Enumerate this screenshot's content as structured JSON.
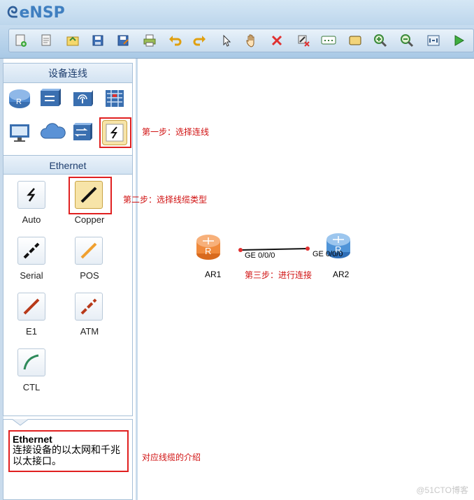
{
  "app": {
    "logo_mark": "ᘓ",
    "title": "eNSP"
  },
  "toolbar": {
    "icons": [
      "new-topology-icon",
      "new-example-icon",
      "open-icon",
      "save-icon",
      "save-as-icon",
      "print-icon",
      "undo-icon",
      "redo-icon",
      "select-icon",
      "pan-hand-icon",
      "delete-icon",
      "delete-link-icon",
      "text-annotation-icon",
      "rectangle-annotation-icon",
      "zoom-in-icon",
      "zoom-out-icon",
      "fit-icon",
      "start-device-icon"
    ]
  },
  "device_panel": {
    "title": "设备连线",
    "ethernet_title": "Ethernet",
    "cables": [
      {
        "label": "Auto"
      },
      {
        "label": "Copper"
      },
      {
        "label": "Serial"
      },
      {
        "label": "POS"
      },
      {
        "label": "E1"
      },
      {
        "label": "ATM"
      },
      {
        "label": "CTL"
      }
    ]
  },
  "description": {
    "title": "Ethernet",
    "text": "连接设备的以太网和千兆以太接口。"
  },
  "annotations": {
    "step1": "第一步：选择连线",
    "step2": "第二步：选择线缆类型",
    "step3": "第三步：进行连接",
    "desc_note": "对应线缆的介绍"
  },
  "topology": {
    "nodes": [
      {
        "name": "AR1",
        "port": "GE 0/0/0",
        "color": "#f08a3c"
      },
      {
        "name": "AR2",
        "port": "GE 0/0/0",
        "color": "#4f94d8"
      }
    ]
  },
  "watermark": "@51CTO博客"
}
